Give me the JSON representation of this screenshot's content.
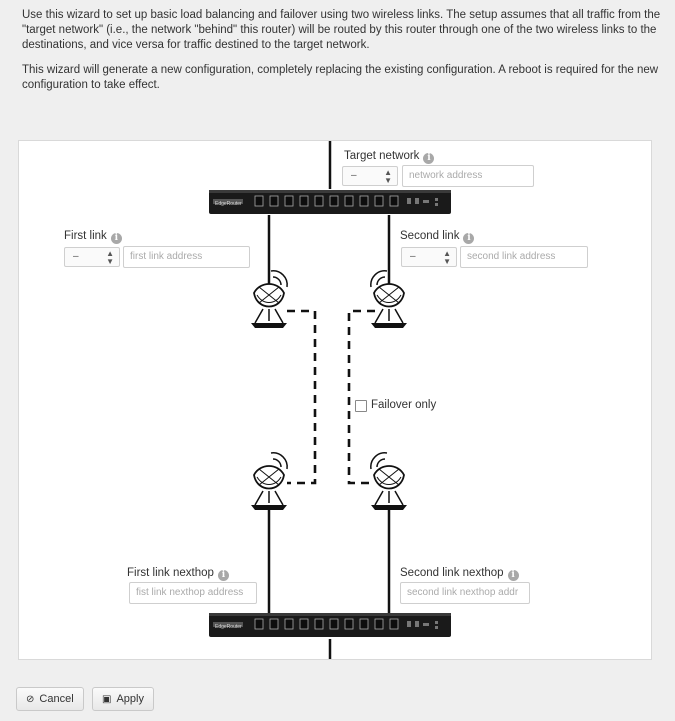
{
  "intro": {
    "paragraph1": "Use this wizard to set up basic load balancing and failover using two wireless links. The setup assumes that all traffic from the \"target network\" (i.e., the network \"behind\" this router) will be routed by this router through one of the two wireless links to the destinations, and vice versa for traffic destined to the target network.",
    "paragraph2": "This wizard will generate a new configuration, completely replacing the existing configuration. A reboot is required for the new configuration to take effect."
  },
  "target_network": {
    "label": "Target network",
    "select_value": "–",
    "placeholder": "network address"
  },
  "first_link": {
    "label": "First link",
    "select_value": "–",
    "placeholder": "first link address"
  },
  "second_link": {
    "label": "Second link",
    "select_value": "–",
    "placeholder": "second link address"
  },
  "failover": {
    "label": "Failover only",
    "checked": false
  },
  "first_nexthop": {
    "label": "First link nexthop",
    "placeholder": "fist link nexthop address"
  },
  "second_nexthop": {
    "label": "Second link nexthop",
    "placeholder": "second link nexthop addr"
  },
  "router_brand": "EdgeRouter",
  "info_glyph": "i",
  "buttons": {
    "cancel": "Cancel",
    "apply": "Apply"
  },
  "icons": {
    "cancel": "cancel-circle-icon",
    "apply": "save-floppy-icon",
    "info": "info-icon",
    "dish": "satellite-dish-icon",
    "router": "router-icon"
  }
}
